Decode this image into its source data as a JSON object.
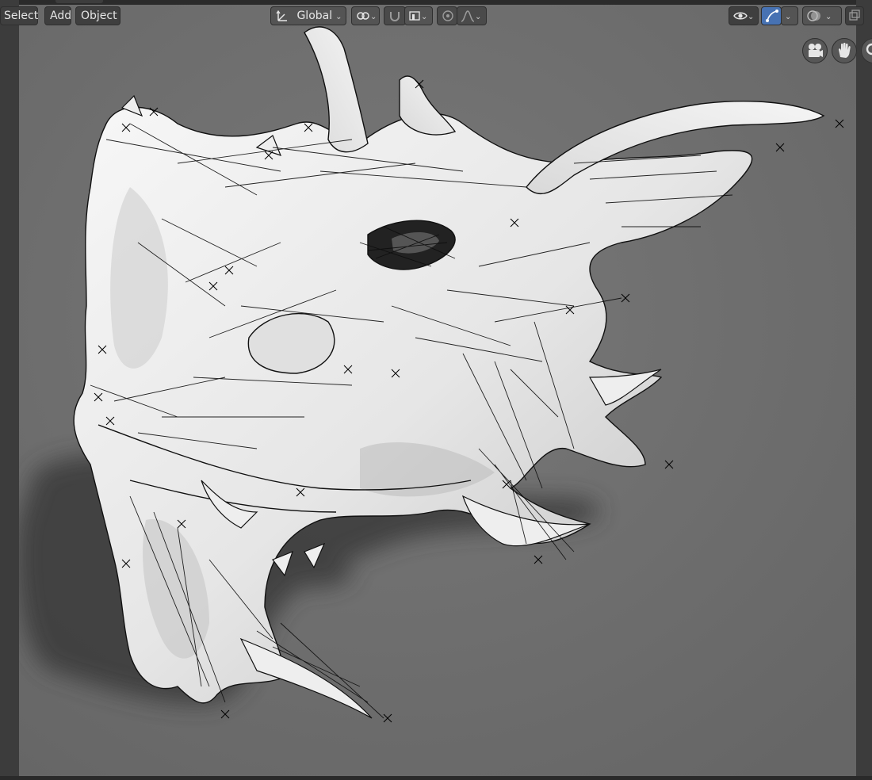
{
  "menu": {
    "select_label": "Select",
    "add_label": "Add",
    "object_label": "Object"
  },
  "toolbar": {
    "transform_orientation": "Global",
    "icons": [
      "orientation-icon",
      "pivot-link-icon",
      "snap-magnet-icon",
      "snap-increment-icon",
      "proportional-edit-icon",
      "falloff-curve-icon",
      "visibility-eye-icon",
      "gizmo-icon",
      "overlays-icon",
      "xray-icon"
    ]
  },
  "navigation": {
    "icons": [
      "camera-view-icon",
      "pan-hand-icon",
      "zoom-magnifier-icon"
    ]
  },
  "colors": {
    "viewport_bg": "#6f6f6f",
    "header_button": "#545454",
    "active_toggle": "#4772b3",
    "panel_dark": "#1d1d1d"
  }
}
